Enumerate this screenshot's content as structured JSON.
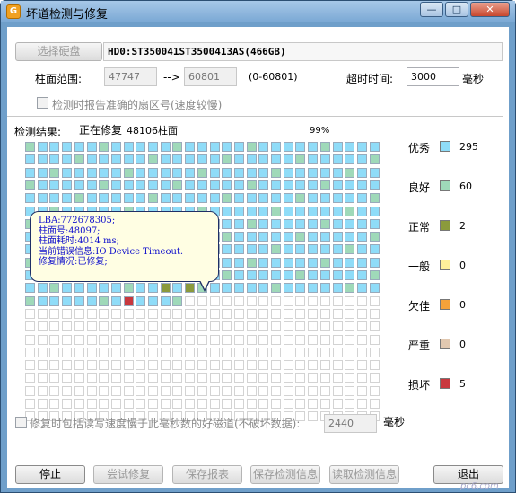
{
  "window": {
    "title": "坏道检测与修复",
    "app_icon_letter": "G"
  },
  "titlebar_buttons": {
    "minimize": "—",
    "maximize": "□",
    "close": "✕"
  },
  "disk": {
    "select_button": "选择硬盘",
    "name": "HD0:ST350041ST3500413AS(466GB)"
  },
  "cylinder_range": {
    "label": "柱面范围:",
    "from": "47747",
    "arrow": "-->",
    "to": "60801",
    "range_note": "(0-60801)"
  },
  "timeout": {
    "label": "超时时间:",
    "value": "3000",
    "unit": "毫秒"
  },
  "report_sector_option": {
    "label": "检测时报告准确的扇区号(速度较慢)",
    "checked": false
  },
  "status": {
    "label": "检测结果:",
    "text": "正在修复",
    "cylinder": "48106柱面",
    "percent": "99%"
  },
  "tooltip": {
    "lines": [
      "LBA:772678305;",
      "柱面号:48097;",
      "柱面耗时:4014 ms;",
      "当前错误信息:IO Device Timeout.",
      "修复情况:已修复;"
    ]
  },
  "grid": {
    "cols": 29,
    "rows": 22,
    "done_cells": 361,
    "colors": {
      "excellent": "#8fdcf8",
      "good": "#9fd9b9",
      "normal": "#8b9a3c",
      "fair": "#fff09a",
      "poor": "#f5a23a",
      "bad_light": "#e1c8b0",
      "damaged": "#c8383e",
      "empty": "#ffffff"
    },
    "normal_cells": [
      330,
      332
    ],
    "damaged_cells": [
      356
    ]
  },
  "legend": [
    {
      "label": "优秀",
      "count": "295",
      "color": "#8fdcf8"
    },
    {
      "label": "良好",
      "count": "60",
      "color": "#9fd9b9"
    },
    {
      "label": "正常",
      "count": "2",
      "color": "#8b9a3c"
    },
    {
      "label": "一般",
      "count": "0",
      "color": "#fff09a"
    },
    {
      "label": "欠佳",
      "count": "0",
      "color": "#f5a23a"
    },
    {
      "label": "严重",
      "count": "0",
      "color": "#e1c8b0"
    },
    {
      "label": "损坏",
      "count": "5",
      "color": "#c8383e"
    }
  ],
  "slow_track_option": {
    "label": "修复时包括读写速度慢于此毫秒数的好磁道(不破坏数据):",
    "value": "2440",
    "unit": "毫秒",
    "checked": false
  },
  "buttons": {
    "stop": "停止",
    "try_repair": "尝试修复",
    "save_report": "保存报表",
    "save_result": "保存检测信息",
    "read_result": "读取检测信息",
    "exit": "退出"
  },
  "watermark": "pc6.com"
}
